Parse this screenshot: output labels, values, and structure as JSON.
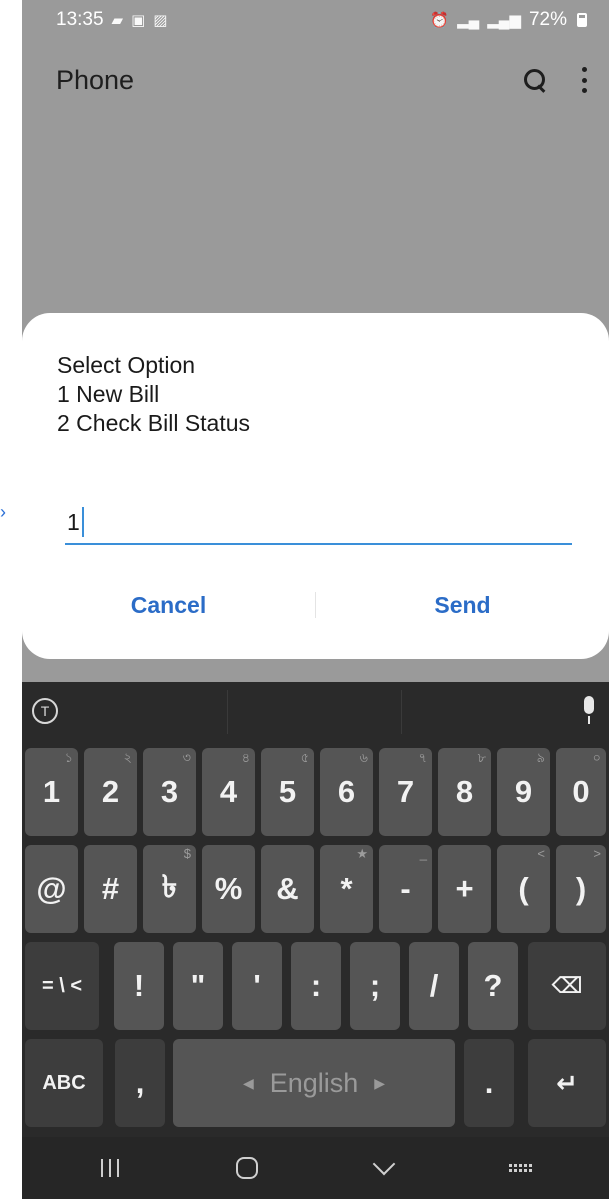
{
  "status_bar": {
    "time": "13:35",
    "left_icons": [
      "message-icon",
      "notification-icon",
      "gallery-icon"
    ],
    "right_icons": [
      "alarm-icon",
      "signal-icon",
      "4g-signal-icon"
    ],
    "battery": "72%"
  },
  "app_bar": {
    "title": "Phone",
    "actions": [
      "search-icon",
      "more-options-icon"
    ]
  },
  "dialog": {
    "message_lines": [
      "Select Option",
      "1 New Bill",
      "2 Check Bill Status"
    ],
    "input_value": "1",
    "cancel_label": "Cancel",
    "send_label": "Send",
    "accent_color": "#2b6cc7"
  },
  "keyboard": {
    "toolbar": [
      "translate-icon",
      "mic-icon"
    ],
    "row1": [
      {
        "label": "1",
        "hint": "১"
      },
      {
        "label": "2",
        "hint": "২"
      },
      {
        "label": "3",
        "hint": "৩"
      },
      {
        "label": "4",
        "hint": "৪"
      },
      {
        "label": "5",
        "hint": "৫"
      },
      {
        "label": "6",
        "hint": "৬"
      },
      {
        "label": "7",
        "hint": "৭"
      },
      {
        "label": "8",
        "hint": "৮"
      },
      {
        "label": "9",
        "hint": "৯"
      },
      {
        "label": "0",
        "hint": "০"
      }
    ],
    "row2": [
      {
        "label": "@",
        "hint": ""
      },
      {
        "label": "#",
        "hint": ""
      },
      {
        "label": "৳",
        "hint": "$"
      },
      {
        "label": "%",
        "hint": ""
      },
      {
        "label": "&",
        "hint": ""
      },
      {
        "label": "*",
        "hint": "★"
      },
      {
        "label": "-",
        "hint": "_"
      },
      {
        "label": "+",
        "hint": ""
      },
      {
        "label": "(",
        "hint": "<"
      },
      {
        "label": ")",
        "hint": ">"
      }
    ],
    "row3": [
      {
        "label": "= \\ <",
        "hint": ""
      },
      {
        "label": "!",
        "hint": ""
      },
      {
        "label": "\"",
        "hint": ""
      },
      {
        "label": "'",
        "hint": ""
      },
      {
        "label": ":",
        "hint": ""
      },
      {
        "label": ";",
        "hint": ""
      },
      {
        "label": "/",
        "hint": ""
      },
      {
        "label": "?",
        "hint": ""
      }
    ],
    "row4": {
      "abc_label": "ABC",
      "comma_label": ",",
      "space_label": "English",
      "period_label": ".",
      "enter_icon": "enter-icon"
    }
  },
  "nav_bar": {
    "buttons": [
      "recents-icon",
      "home-icon",
      "back-icon",
      "keyboard-icon"
    ]
  }
}
